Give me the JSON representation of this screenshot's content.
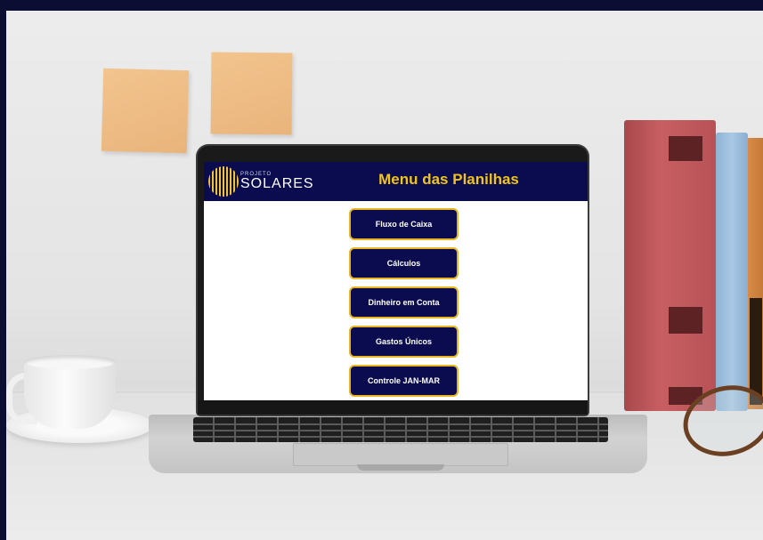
{
  "screen": {
    "logo": {
      "small_text": "PROJETO",
      "brand": "SOLARES"
    },
    "title": "Menu das Planilhas",
    "menu_buttons": [
      {
        "label": "Fluxo de Caixa"
      },
      {
        "label": "Cálculos"
      },
      {
        "label": "Dinheiro em Conta"
      },
      {
        "label": "Gastos Únicos"
      },
      {
        "label": "Controle JAN-MAR"
      }
    ]
  },
  "colors": {
    "navy": "#0a0c4f",
    "gold": "#f0c419",
    "button_border": "#e8b422"
  }
}
